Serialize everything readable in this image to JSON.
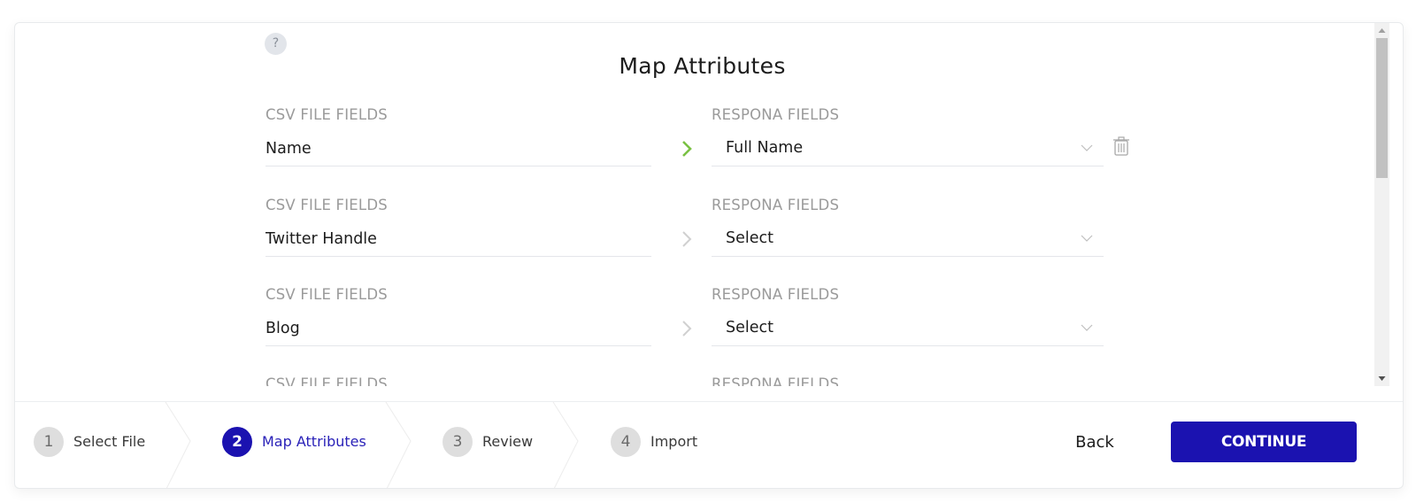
{
  "title": "Map Attributes",
  "help_icon": "?",
  "colors": {
    "accent": "#1b12b0",
    "mapped_arrow": "#7ac143",
    "unmapped_arrow": "#d0d0d0"
  },
  "labels": {
    "csv": "CSV FILE FIELDS",
    "respona": "RESPONA FIELDS"
  },
  "mappings": [
    {
      "csv_field": "Name",
      "respona_field": "Full Name",
      "mapped": true,
      "deletable": true
    },
    {
      "csv_field": "Twitter Handle",
      "respona_field": "Select",
      "mapped": false,
      "deletable": false
    },
    {
      "csv_field": "Blog",
      "respona_field": "Select",
      "mapped": false,
      "deletable": false
    }
  ],
  "partial_row": {
    "csv_label": "CSV FILE FIELDS",
    "respona_label": "RESPONA FIELDS"
  },
  "steps": [
    {
      "number": "1",
      "label": "Select File",
      "active": false
    },
    {
      "number": "2",
      "label": "Map Attributes",
      "active": true
    },
    {
      "number": "3",
      "label": "Review",
      "active": false
    },
    {
      "number": "4",
      "label": "Import",
      "active": false
    }
  ],
  "actions": {
    "back": "Back",
    "continue": "CONTINUE"
  }
}
